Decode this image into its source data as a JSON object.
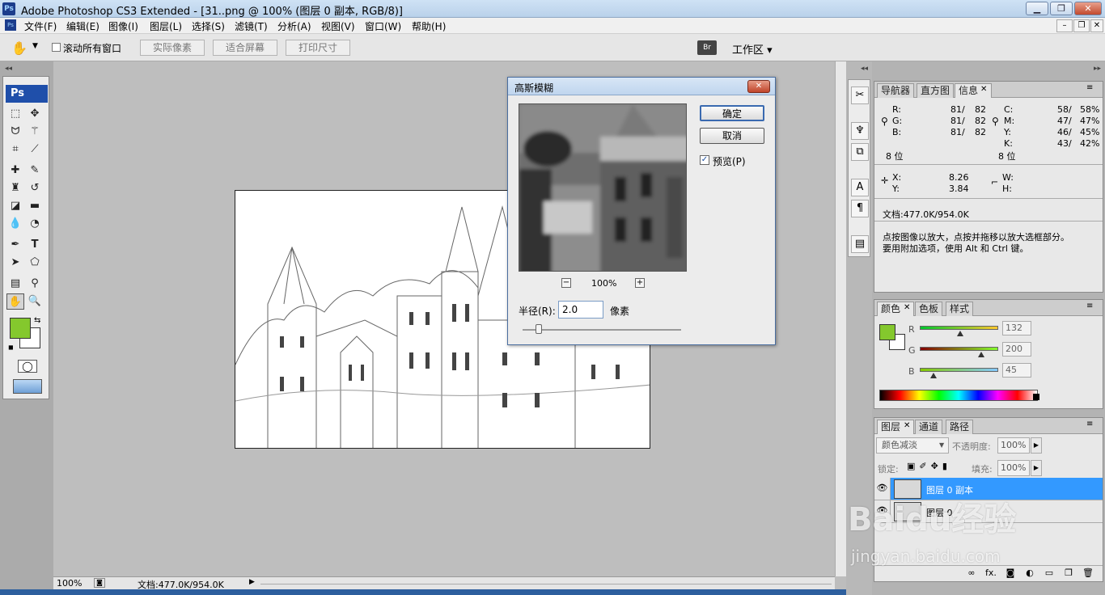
{
  "titlebar": {
    "title": "Adobe Photoshop CS3 Extended - [31..png @ 100% (图层 0 副本, RGB/8)]",
    "app_icon": "Ps",
    "minimize": "▁",
    "restore": "❐",
    "close": "✕"
  },
  "menubar": {
    "items": [
      "文件(F)",
      "编辑(E)",
      "图像(I)",
      "图层(L)",
      "选择(S)",
      "滤镜(T)",
      "分析(A)",
      "视图(V)",
      "窗口(W)",
      "帮助(H)"
    ],
    "min": "–",
    "restore": "❐",
    "close": "✕"
  },
  "options": {
    "scroll_all_label": "滚动所有窗口",
    "actual_pixels": "实际像素",
    "fit_screen": "适合屏幕",
    "print_size": "打印尺寸",
    "workspace": "工作区 ▾",
    "bridge_icon": "Br"
  },
  "toolbox": {
    "logo": "Ps"
  },
  "status": {
    "zoom": "100%",
    "doc": "文档:477.0K/954.0K"
  },
  "dialog": {
    "title": "高斯模糊",
    "ok": "确定",
    "cancel": "取消",
    "preview_label": "预览(P)",
    "preview_checked": true,
    "zoom": "100%",
    "zoom_minus": "−",
    "zoom_plus": "+",
    "radius_label": "半径(R):",
    "radius_value": "2.0",
    "radius_unit": "像素",
    "radius_slider_fraction": 0.1
  },
  "info_panel": {
    "tabs": [
      "导航器",
      "直方图",
      "信息"
    ],
    "active_tab": "信息",
    "rgb": [
      {
        "k": "R:",
        "v1": "81/",
        "v2": "82"
      },
      {
        "k": "G:",
        "v1": "81/",
        "v2": "82"
      },
      {
        "k": "B:",
        "v1": "81/",
        "v2": "82"
      }
    ],
    "cmyk": [
      {
        "k": "C:",
        "v1": "58/",
        "v2": "58%"
      },
      {
        "k": "M:",
        "v1": "47/",
        "v2": "47%"
      },
      {
        "k": "Y:",
        "v1": "46/",
        "v2": "45%"
      },
      {
        "k": "K:",
        "v1": "43/",
        "v2": "42%"
      }
    ],
    "bit_left": "8 位",
    "bit_right": "8 位",
    "x_label": "X:",
    "x_value": "8.26",
    "y_label": "Y:",
    "y_value": "3.84",
    "w_label": "W:",
    "h_label": "H:",
    "doc": "文档:477.0K/954.0K",
    "hint1": "点按图像以放大，点按并拖移以放大选框部分。",
    "hint2": "要用附加选项，使用 Alt 和 Ctrl 键。"
  },
  "color_panel": {
    "tabs": [
      "颜色",
      "色板",
      "样式"
    ],
    "active_tab": "颜色",
    "fg_color": "#84c82d",
    "channels": [
      {
        "label": "R",
        "value": "132",
        "fraction": 0.518
      },
      {
        "label": "G",
        "value": "200",
        "fraction": 0.784
      },
      {
        "label": "B",
        "value": "45",
        "fraction": 0.176
      }
    ]
  },
  "layers_panel": {
    "tabs": [
      "图层",
      "通道",
      "路径"
    ],
    "active_tab": "图层",
    "blend_mode": "颜色减淡",
    "opacity_label": "不透明度:",
    "opacity": "100%",
    "lock_label": "锁定:",
    "fill_label": "填充:",
    "fill": "100%",
    "layers": [
      {
        "name": "图层 0 副本",
        "selected": true
      },
      {
        "name": "图层 0",
        "selected": false
      }
    ],
    "footer_icons": [
      "∞",
      "fx.",
      "◙",
      "◐",
      "▭",
      "❐",
      "🗑"
    ]
  },
  "watermark": {
    "line1": "Baidu经验",
    "line2": "jingyan.baidu.com"
  },
  "colors": {
    "accent": "#3399ff",
    "fg": "#84c82d"
  }
}
